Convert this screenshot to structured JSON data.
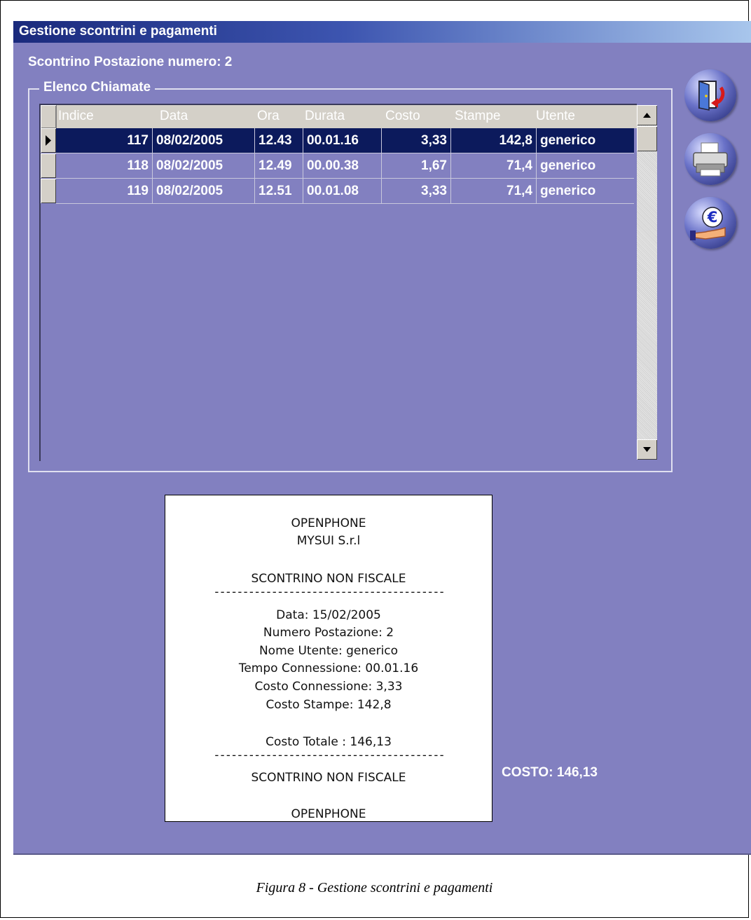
{
  "window": {
    "title": "Gestione scontrini e pagamenti"
  },
  "station_label": "Scontrino Postazione numero: 2",
  "group_title": "Elenco Chiamate",
  "table": {
    "columns": [
      "Indice",
      "Data",
      "Ora",
      "Durata",
      "Costo",
      "Stampe",
      "Utente"
    ],
    "rows": [
      {
        "indice": "117",
        "data": "08/02/2005",
        "ora": "12.43",
        "durata": "00.01.16",
        "costo": "3,33",
        "stampe": "142,8",
        "utente": "generico",
        "selected": true
      },
      {
        "indice": "118",
        "data": "08/02/2005",
        "ora": "12.49",
        "durata": "00.00.38",
        "costo": "1,67",
        "stampe": "71,4",
        "utente": "generico",
        "selected": false
      },
      {
        "indice": "119",
        "data": "08/02/2005",
        "ora": "12.51",
        "durata": "00.01.08",
        "costo": "3,33",
        "stampe": "71,4",
        "utente": "generico",
        "selected": false
      }
    ]
  },
  "toolbar": {
    "icons": [
      "exit-door-icon",
      "printer-icon",
      "euro-payment-icon"
    ]
  },
  "receipt": {
    "lines": [
      "OPENPHONE",
      "MYSUI S.r.l",
      "SCONTRINO NON FISCALE",
      "----------------------------------------",
      "Data: 15/02/2005",
      "Numero Postazione: 2",
      "Nome Utente: generico",
      "Tempo Connessione: 00.01.16",
      "Costo Connessione: 3,33",
      "Costo Stampe: 142,8",
      "Costo Totale : 146,13",
      "----------------------------------------",
      "SCONTRINO NON FISCALE",
      "OPENPHONE"
    ]
  },
  "total_label": "COSTO: 146,13",
  "caption": "Figura 8 - Gestione scontrini e pagamenti",
  "colors": {
    "window_bg": "#8280c0",
    "selected_row": "#0c1a5c",
    "title_start": "#1a2a7c",
    "title_end": "#a8c6ec"
  }
}
